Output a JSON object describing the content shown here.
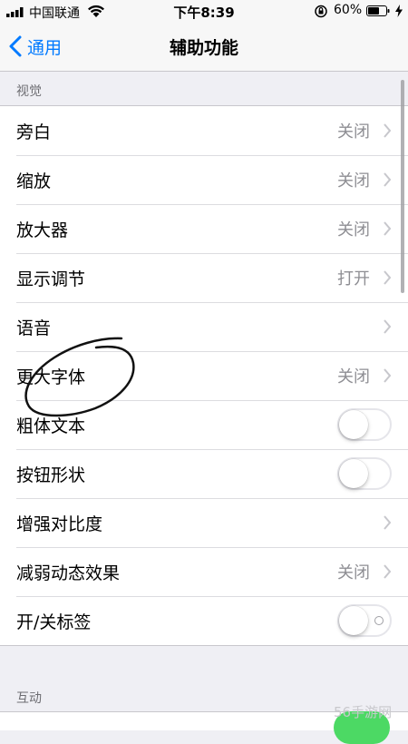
{
  "status_bar": {
    "carrier": "中国联通",
    "time": "下午8:39",
    "battery": "60%"
  },
  "nav": {
    "back_label": "通用",
    "title": "辅助功能"
  },
  "sections": {
    "vision_header": "视觉",
    "interaction_header": "互动"
  },
  "rows": [
    {
      "label": "旁白",
      "value": "关闭"
    },
    {
      "label": "缩放",
      "value": "关闭"
    },
    {
      "label": "放大器",
      "value": "关闭"
    },
    {
      "label": "显示调节",
      "value": "打开"
    },
    {
      "label": "语音",
      "value": ""
    },
    {
      "label": "更大字体",
      "value": "关闭"
    },
    {
      "label": "粗体文本"
    },
    {
      "label": "按钮形状"
    },
    {
      "label": "增强对比度",
      "value": ""
    },
    {
      "label": "减弱动态效果",
      "value": "关闭"
    },
    {
      "label": "开/关标签"
    }
  ],
  "toggles": {
    "bold_text": false,
    "button_shapes": false,
    "on_off_labels": false
  },
  "colors": {
    "accent": "#007aff",
    "toggle_on": "#4cd964",
    "background": "#efeff4"
  },
  "watermark": "56手游网"
}
